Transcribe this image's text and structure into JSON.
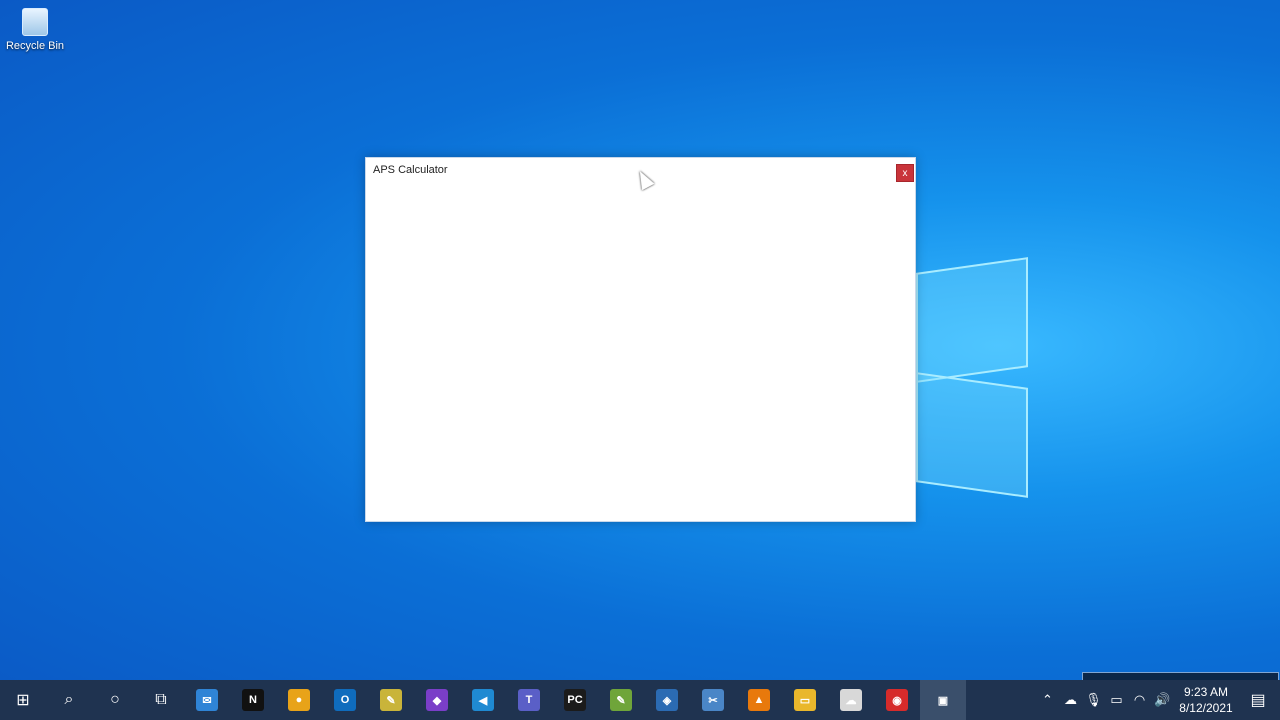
{
  "desktop": {
    "icons": [
      {
        "label": "Recycle Bin",
        "icon": "recycle-bin-icon"
      }
    ]
  },
  "window": {
    "title": "APS Calculator",
    "close_label": "x"
  },
  "taskbar": {
    "items": [
      {
        "name": "start",
        "icon": "windows-start-icon",
        "glyph": "⊞",
        "color": "#ffffff"
      },
      {
        "name": "search",
        "icon": "search-icon",
        "glyph": "⌕",
        "color": "#ffffff"
      },
      {
        "name": "cortana",
        "icon": "cortana-icon",
        "glyph": "○",
        "color": "#ffffff"
      },
      {
        "name": "task-view",
        "icon": "task-view-icon",
        "glyph": "⧉",
        "color": "#ffffff"
      },
      {
        "name": "mail",
        "icon": "mail-icon",
        "glyph": "✉",
        "color": "#2f84d6"
      },
      {
        "name": "netflix",
        "icon": "netflix-icon",
        "glyph": "N",
        "color": "#111111"
      },
      {
        "name": "chrome",
        "icon": "chrome-icon",
        "glyph": "●",
        "color": "#e8a319"
      },
      {
        "name": "outlook",
        "icon": "outlook-icon",
        "glyph": "O",
        "color": "#0f6cbd"
      },
      {
        "name": "sticky-notes",
        "icon": "sticky-notes-icon",
        "glyph": "✎",
        "color": "#c9b43a"
      },
      {
        "name": "visual-studio",
        "icon": "visual-studio-icon",
        "glyph": "◆",
        "color": "#7a3ec8"
      },
      {
        "name": "vs-code",
        "icon": "vs-code-icon",
        "glyph": "◀",
        "color": "#1f8ad2"
      },
      {
        "name": "teams",
        "icon": "teams-icon",
        "glyph": "T",
        "color": "#5a5fc7"
      },
      {
        "name": "pycharm",
        "icon": "pycharm-icon",
        "glyph": "PC",
        "color": "#1b1b1b"
      },
      {
        "name": "notepad-plus",
        "icon": "notepad-plus-icon",
        "glyph": "✎",
        "color": "#6fa53a"
      },
      {
        "name": "virtualbox",
        "icon": "virtualbox-icon",
        "glyph": "◈",
        "color": "#2b6bb3"
      },
      {
        "name": "snipping-tool",
        "icon": "snipping-tool-icon",
        "glyph": "✂",
        "color": "#4a86c7"
      },
      {
        "name": "vlc",
        "icon": "vlc-icon",
        "glyph": "▲",
        "color": "#e8790c"
      },
      {
        "name": "file-explorer",
        "icon": "file-explorer-icon",
        "glyph": "▭",
        "color": "#e9b72c"
      },
      {
        "name": "cloud-app",
        "icon": "cloud-app-icon",
        "glyph": "☁",
        "color": "#d8d8d8"
      },
      {
        "name": "screen-recorder",
        "icon": "screen-recorder-icon",
        "glyph": "◉",
        "color": "#d62b2b"
      },
      {
        "name": "active-window",
        "icon": "window-app-icon",
        "glyph": "▣",
        "color": "#3a4f6b"
      }
    ]
  },
  "tray": {
    "icons": [
      {
        "name": "show-hidden",
        "icon": "chevron-up-icon",
        "glyph": "⌃"
      },
      {
        "name": "onedrive",
        "icon": "onedrive-icon",
        "glyph": "☁"
      },
      {
        "name": "microphone",
        "icon": "microphone-icon",
        "glyph": "🎙"
      },
      {
        "name": "battery",
        "icon": "battery-icon",
        "glyph": "▭"
      },
      {
        "name": "wifi",
        "icon": "wifi-icon",
        "glyph": "◠"
      },
      {
        "name": "volume",
        "icon": "volume-icon",
        "glyph": "🔊"
      }
    ],
    "time": "9:23 AM",
    "date": "8/12/2021",
    "notifications_icon": "notification-icon"
  }
}
